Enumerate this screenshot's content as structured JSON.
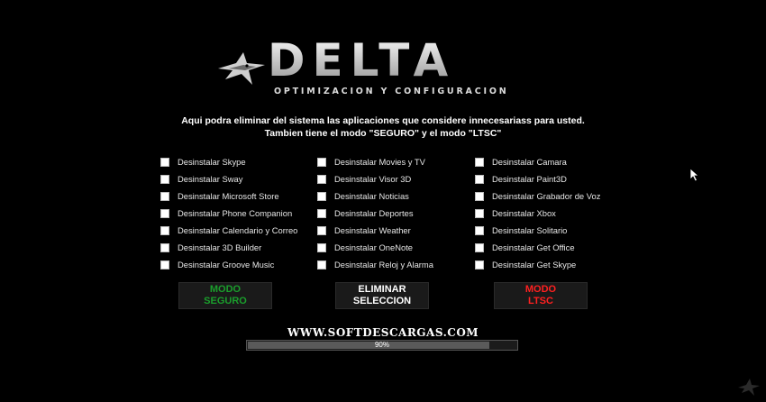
{
  "logo": {
    "title": "DELTA",
    "subtitle": "OPTIMIZACION Y CONFIGURACION"
  },
  "description": {
    "line1": "Aqui podra eliminar del sistema las aplicaciones que considere innecesariass para usted.",
    "line2": "Tambien tiene el modo \"SEGURO\" y el modo \"LTSC\""
  },
  "options": {
    "col1": [
      "Desinstalar Skype",
      "Desinstalar Sway",
      "Desinstalar Microsoft Store",
      "Desinstalar Phone Companion",
      "Desinstalar Calendario y Correo",
      "Desinstalar 3D Builder",
      "Desinstalar Groove Music"
    ],
    "col2": [
      "Desinstalar Movies y TV",
      "Desinstalar Visor 3D",
      "Desinstalar Noticias",
      "Desinstalar Deportes",
      "Desinstalar Weather",
      "Desinstalar OneNote",
      "Desinstalar Reloj y Alarma"
    ],
    "col3": [
      "Desinstalar Camara",
      "Desinstalar Paint3D",
      "Desinstalar Grabador de Voz",
      "Desinstalar Xbox",
      "Desinstalar Solitario",
      "Desinstalar Get Office",
      "Desinstalar Get Skype"
    ]
  },
  "buttons": {
    "seguro": {
      "line1": "MODO",
      "line2": "SEGURO",
      "color": "#1a9e2c"
    },
    "eliminar": {
      "line1": "ELIMINAR",
      "line2": "SELECCION",
      "color": "#ffffff"
    },
    "ltsc": {
      "line1": "MODO",
      "line2": "LTSC",
      "color": "#ff2020"
    }
  },
  "watermark": "WWW.SOFTDESCARGAS.COM",
  "progress": {
    "value": 90,
    "label": "90%"
  }
}
